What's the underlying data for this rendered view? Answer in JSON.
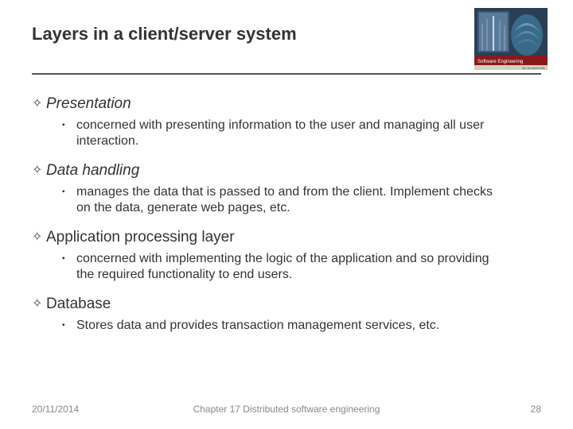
{
  "title": "Layers in a client/server system",
  "logo": {
    "caption": "Software Engineering",
    "author": "Ian Sommerville"
  },
  "items": [
    {
      "heading": "Presentation",
      "italic": true,
      "sub": "concerned with presenting information to the user and managing all user interaction."
    },
    {
      "heading": "Data handling",
      "italic": true,
      "sub": "manages the data that is passed to and from the client. Implement checks on the data, generate web pages, etc."
    },
    {
      "heading": "Application processing layer",
      "italic": false,
      "sub": "concerned with implementing the logic of the application and so providing the required functionality to end users."
    },
    {
      "heading": "Database",
      "italic": false,
      "sub": "Stores data and provides transaction management services, etc."
    }
  ],
  "footer": {
    "date": "20/11/2014",
    "chapter": "Chapter 17 Distributed software engineering",
    "page": "28"
  }
}
